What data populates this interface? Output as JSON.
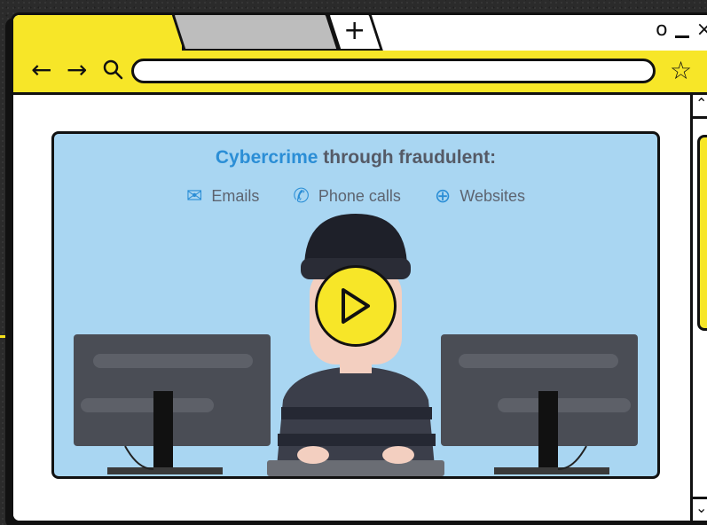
{
  "browser": {
    "new_tab_label": "+",
    "window_controls": {
      "restore": "o",
      "minimize": "_",
      "close": "×"
    },
    "toolbar": {
      "back_icon": "←",
      "forward_icon": "→",
      "search_icon": "⚲",
      "star_icon": "☆"
    },
    "address_value": ""
  },
  "video": {
    "title_highlight": "Cybercrime",
    "title_rest": "through fraudulent:",
    "channels": [
      {
        "icon": "✉",
        "label": "Emails"
      },
      {
        "icon": "✆",
        "label": "Phone calls"
      },
      {
        "icon": "⊕",
        "label": "Websites"
      }
    ]
  },
  "colors": {
    "accent_yellow": "#f7e628",
    "video_bg": "#a9d6f2",
    "highlight_blue": "#2b8ed6",
    "outline": "#111111"
  }
}
